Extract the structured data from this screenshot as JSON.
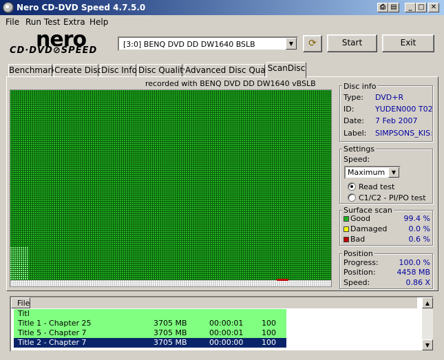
{
  "window": {
    "title": "Nero CD-DVD Speed 4.7.5.0"
  },
  "menu": [
    "File",
    "Run Test",
    "Extra",
    "Help"
  ],
  "logo": {
    "nero": "nero",
    "sub": "CD·DVD⊘SPEED"
  },
  "drive": {
    "selected": "[3:0]   BENQ DVD DD DW1640 BSLB"
  },
  "buttons": {
    "start": "Start",
    "exit": "Exit"
  },
  "tabs": [
    "Benchmark",
    "Create Disc",
    "Disc Info",
    "Disc Quality",
    "Advanced Disc Quality",
    "ScanDisc"
  ],
  "active_tab": "ScanDisc",
  "recorded_with": "recorded with BENQ     DVD DD DW1640     vBSLB",
  "scan": {
    "good_fraction": 0.994,
    "damaged_fraction": 0.0,
    "bad_fraction": 0.006,
    "colors": {
      "good": "#21b521",
      "damaged": "#ffff00",
      "bad": "#c00000",
      "unscanned": "#c0c0c0",
      "partial": "#80ff80"
    }
  },
  "disc_info": {
    "title": "Disc info",
    "type_label": "Type:",
    "type": "DVD+R",
    "id_label": "ID:",
    "id": "YUDEN000 T02",
    "date_label": "Date:",
    "date": "7 Feb 2007",
    "label_label": "Label:",
    "label": "SIMPSONS_KIS:"
  },
  "settings": {
    "title": "Settings",
    "speed_label": "Speed:",
    "speed": "Maximum",
    "read_test": "Read test",
    "c1c2_test": "C1/C2 - PI/PO test"
  },
  "surface_scan": {
    "title": "Surface scan",
    "good_label": "Good",
    "good": "99.4 %",
    "damaged_label": "Damaged",
    "damaged": "0.0 %",
    "bad_label": "Bad",
    "bad": "0.6 %"
  },
  "position": {
    "title": "Position",
    "progress_label": "Progress:",
    "progress": "100.0 %",
    "position_label": "Position:",
    "position": "4458 MB",
    "speed_label": "Speed:",
    "speed": "0.86 X"
  },
  "file_list": {
    "header": "File",
    "partial_row": "Titl",
    "rows": [
      {
        "name": "Title 1 - Chapter 25",
        "size": "3705 MB",
        "time": "00:00:01",
        "val": "100",
        "state": "good"
      },
      {
        "name": "Title 5 - Chapter 7",
        "size": "3705 MB",
        "time": "00:00:01",
        "val": "100",
        "state": "good"
      },
      {
        "name": "Title 2 - Chapter 7",
        "size": "3705 MB",
        "time": "00:00:00",
        "val": "100",
        "state": "selected"
      }
    ]
  }
}
